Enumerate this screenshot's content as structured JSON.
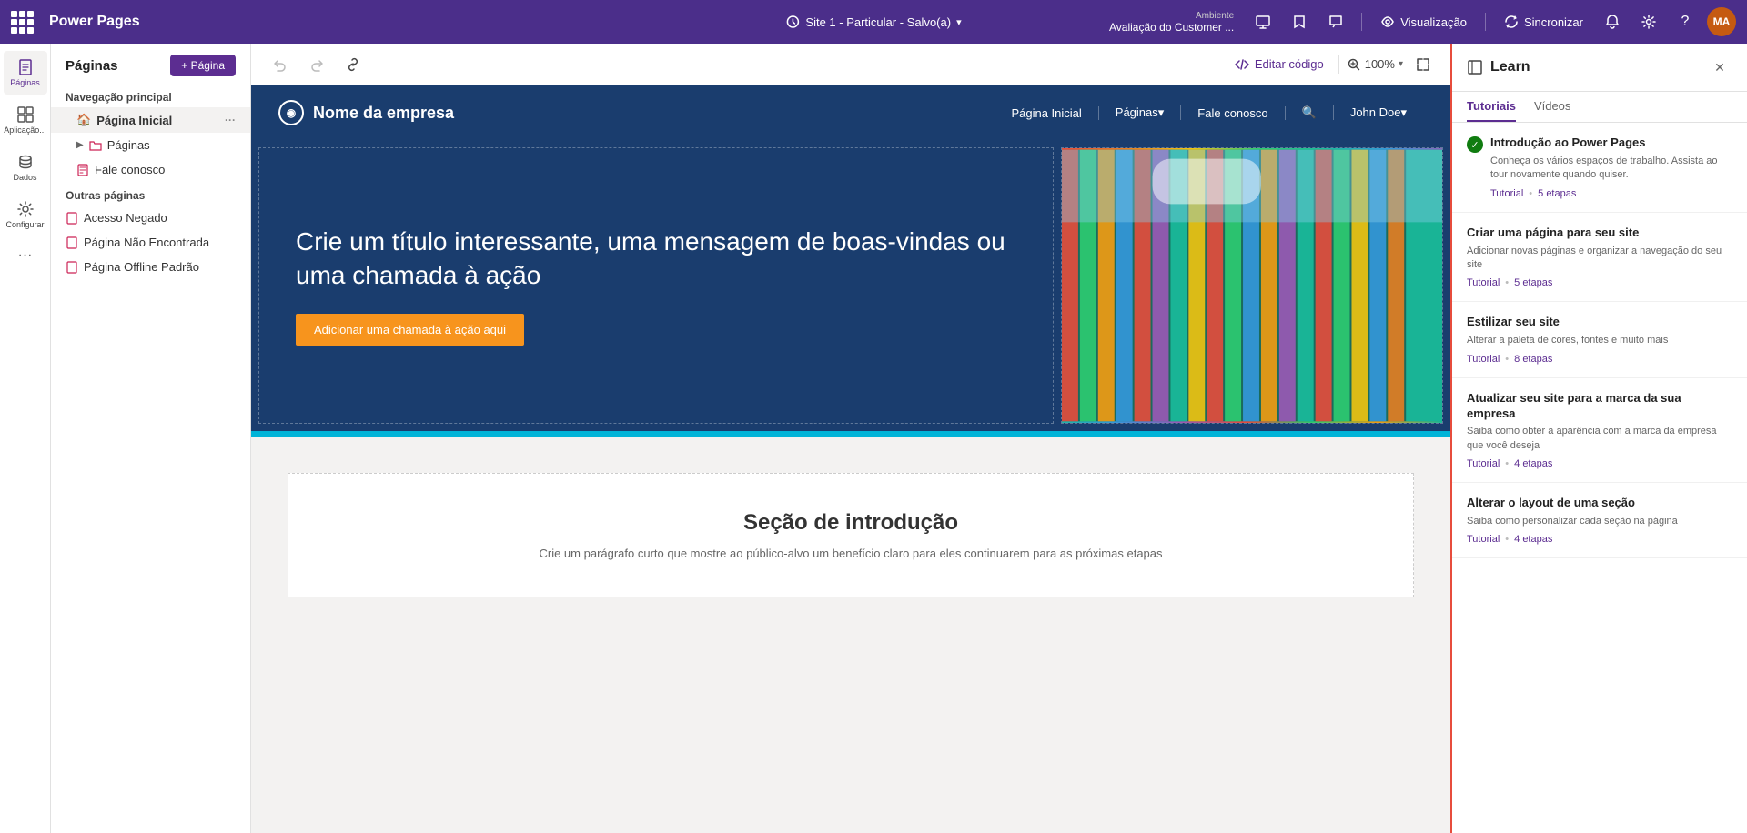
{
  "app": {
    "title": "Power Pages"
  },
  "environment": {
    "label": "Ambiente",
    "name": "Avaliação do Customer ..."
  },
  "top_center": {
    "site_info": "Site 1 - Particular - Salvo(a)"
  },
  "second_toolbar": {
    "edit_code": "Editar código",
    "zoom": "100%",
    "preview": "Visualização",
    "sync": "Sincronizar"
  },
  "sidebar": {
    "items": [
      {
        "label": "Páginas",
        "icon": "pages-icon",
        "active": true
      },
      {
        "label": "Aplicação...",
        "icon": "app-icon",
        "active": false
      },
      {
        "label": "Dados",
        "icon": "data-icon",
        "active": false
      },
      {
        "label": "Configurar",
        "icon": "config-icon",
        "active": false
      }
    ]
  },
  "pages_panel": {
    "title": "Páginas",
    "add_button": "+ Página",
    "main_nav_title": "Navegação principal",
    "other_pages_title": "Outras páginas",
    "main_nav_items": [
      {
        "label": "Página Inicial",
        "type": "page",
        "active": true,
        "indent": 1
      },
      {
        "label": "Páginas",
        "type": "folder",
        "active": false,
        "indent": 1
      },
      {
        "label": "Fale conosco",
        "type": "page",
        "active": false,
        "indent": 1
      }
    ],
    "other_pages": [
      {
        "label": "Acesso Negado",
        "type": "page"
      },
      {
        "label": "Página Não Encontrada",
        "type": "page"
      },
      {
        "label": "Página Offline Padrão",
        "type": "page"
      }
    ]
  },
  "canvas": {
    "site_logo": "Nome da empresa",
    "nav_links": [
      {
        "label": "Página Inicial"
      },
      {
        "label": "Páginas▾"
      },
      {
        "label": "Fale conosco"
      },
      {
        "label": "🔍"
      },
      {
        "label": "John Doe▾"
      }
    ],
    "hero": {
      "title": "Crie um título interessante, uma mensagem de boas-vindas ou uma chamada à ação",
      "cta": "Adicionar uma chamada à ação aqui"
    },
    "intro": {
      "title": "Seção de introdução",
      "text": "Crie um parágrafo curto que mostre ao público-alvo um benefício claro para eles continuarem para as próximas etapas"
    }
  },
  "learn_panel": {
    "title": "Learn",
    "close_label": "✕",
    "tabs": [
      {
        "label": "Tutoriais",
        "active": true
      },
      {
        "label": "Vídeos",
        "active": false
      }
    ],
    "tutorials": [
      {
        "title": "Introdução ao Power Pages",
        "desc": "Conheça os vários espaços de trabalho. Assista ao tour novamente quando quiser.",
        "type": "Tutorial",
        "steps": "5 etapas",
        "completed": true
      },
      {
        "title": "Criar uma página para seu site",
        "desc": "Adicionar novas páginas e organizar a navegação do seu site",
        "type": "Tutorial",
        "steps": "5 etapas",
        "completed": false
      },
      {
        "title": "Estilizar seu site",
        "desc": "Alterar a paleta de cores, fontes e muito mais",
        "type": "Tutorial",
        "steps": "8 etapas",
        "completed": false
      },
      {
        "title": "Atualizar seu site para a marca da sua empresa",
        "desc": "Saiba como obter a aparência com a marca da empresa que você deseja",
        "type": "Tutorial",
        "steps": "4 etapas",
        "completed": false
      },
      {
        "title": "Alterar o layout de uma seção",
        "desc": "Saiba como personalizar cada seção na página",
        "type": "Tutorial",
        "steps": "4 etapas",
        "completed": false
      }
    ]
  },
  "avatar": {
    "initials": "MA"
  }
}
